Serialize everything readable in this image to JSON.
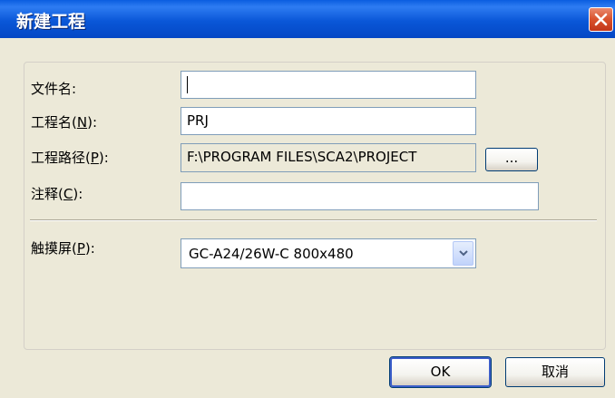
{
  "window": {
    "title": "新建工程"
  },
  "form": {
    "file_name": {
      "label": "文件名:",
      "value": ""
    },
    "project_name": {
      "label_prefix": "工程名(",
      "label_key": "N",
      "label_suffix": "):",
      "value": "PRJ"
    },
    "project_path": {
      "label_prefix": "工程路径(",
      "label_key": "P",
      "label_suffix": "):",
      "value": "F:\\PROGRAM FILES\\SCA2\\PROJECT",
      "browse_label": "..."
    },
    "comment": {
      "label_prefix": "注释(",
      "label_key": "C",
      "label_suffix": "):",
      "value": ""
    },
    "touchscreen": {
      "label_prefix": "触摸屏(",
      "label_key": "P",
      "label_suffix": "):",
      "selected": "GC-A24/26W-C 800x480"
    }
  },
  "buttons": {
    "ok": "OK",
    "cancel": "取消"
  },
  "colors": {
    "title_bar": "#0a57d8",
    "dialog_bg": "#ece9d8",
    "close_button": "#d9512c"
  }
}
